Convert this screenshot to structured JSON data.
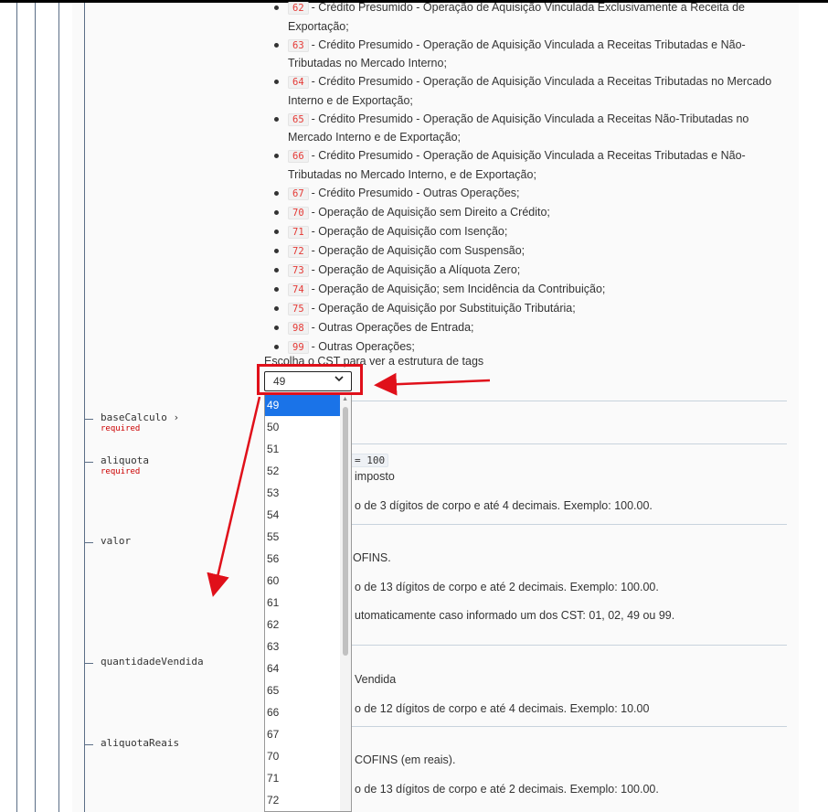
{
  "cst_list": [
    {
      "code": "62",
      "text": "- Crédito Presumido - Operação de Aquisição Vinculada Exclusivamente a Receita de",
      "text2": "Exportação;"
    },
    {
      "code": "63",
      "text": "- Crédito Presumido - Operação de Aquisição Vinculada a Receitas Tributadas e Não-",
      "text2": "Tributadas no Mercado Interno;"
    },
    {
      "code": "64",
      "text": "- Crédito Presumido - Operação de Aquisição Vinculada a Receitas Tributadas no Mercado",
      "text2": "Interno e de Exportação;"
    },
    {
      "code": "65",
      "text": "- Crédito Presumido - Operação de Aquisição Vinculada a Receitas Não-Tributadas no",
      "text2": "Mercado Interno e de Exportação;"
    },
    {
      "code": "66",
      "text": "- Crédito Presumido - Operação de Aquisição Vinculada a Receitas Tributadas e Não-",
      "text2": "Tributadas no Mercado Interno, e de Exportação;"
    },
    {
      "code": "67",
      "text": "- Crédito Presumido - Outras Operações;",
      "text2": ""
    },
    {
      "code": "70",
      "text": "- Operação de Aquisição sem Direito a Crédito;",
      "text2": ""
    },
    {
      "code": "71",
      "text": "- Operação de Aquisição com Isenção;",
      "text2": ""
    },
    {
      "code": "72",
      "text": "- Operação de Aquisição com Suspensão;",
      "text2": ""
    },
    {
      "code": "73",
      "text": "- Operação de Aquisição a Alíquota Zero;",
      "text2": ""
    },
    {
      "code": "74",
      "text": "- Operação de Aquisição; sem Incidência da Contribuição;",
      "text2": ""
    },
    {
      "code": "75",
      "text": "- Operação de Aquisição por Substituição Tributária;",
      "text2": ""
    },
    {
      "code": "98",
      "text": "- Outras Operações de Entrada;",
      "text2": ""
    },
    {
      "code": "99",
      "text": "- Outras Operações;",
      "text2": ""
    }
  ],
  "choose_label": "Escolha o CST para ver a estrutura de tags",
  "select_value": "49",
  "dropdown_options": [
    "49",
    "50",
    "51",
    "52",
    "53",
    "54",
    "55",
    "56",
    "60",
    "61",
    "62",
    "63",
    "64",
    "65",
    "66",
    "67",
    "70",
    "71",
    "72"
  ],
  "properties": [
    {
      "name": "baseCalculo",
      "suffix": "›",
      "required": "required"
    },
    {
      "name": "aliquota",
      "suffix": "",
      "required": "required"
    },
    {
      "name": "valor",
      "suffix": "",
      "required": ""
    },
    {
      "name": "quantidadeVendida",
      "suffix": "",
      "required": ""
    },
    {
      "name": "aliquotaReais",
      "suffix": "",
      "required": ""
    }
  ],
  "desc_fragments": {
    "aliquota_badge": "= 100",
    "aliquota_line1": "imposto",
    "aliquota_line2": "o de 3 dígitos de corpo e até 4 decimais. Exemplo: 100.00.",
    "valor_line1": "OFINS.",
    "valor_line2": "o de 13 dígitos de corpo e até 2 decimais. Exemplo: 100.00.",
    "valor_line3": "utomaticamente caso informado um dos CST: 01, 02, 49 ou 99.",
    "qv_line1": "Vendida",
    "qv_line2": "o de 12 dígitos de corpo e até 4 decimais. Exemplo: 10.00",
    "ar_line1": "COFINS (em reais).",
    "ar_line2": "o de 13 dígitos de corpo e até 2 decimais. Exemplo: 100.00."
  },
  "annotation_color": "#e0101a"
}
